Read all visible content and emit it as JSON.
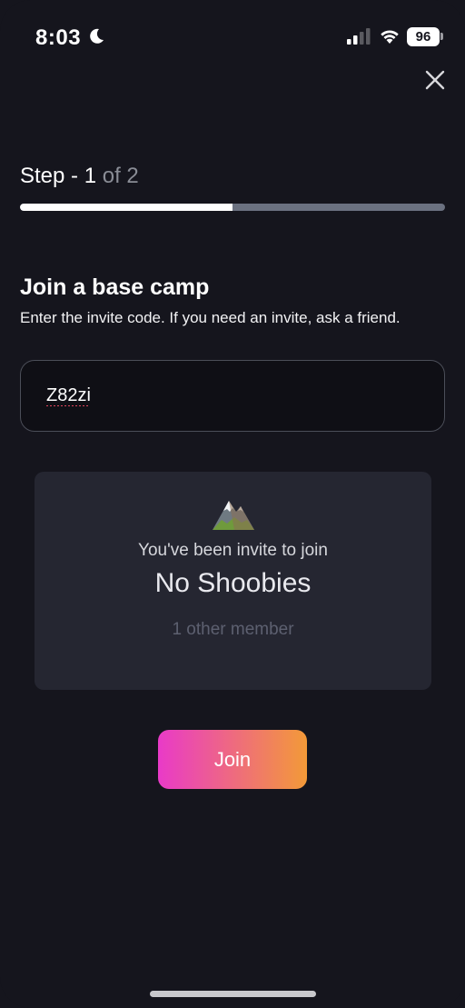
{
  "status_bar": {
    "time": "8:03",
    "battery": "96",
    "icons": [
      "moon-icon",
      "cellular-signal-icon",
      "wifi-icon",
      "battery-icon"
    ]
  },
  "header": {
    "close_icon": "close-icon"
  },
  "step": {
    "prefix": "Step - 1",
    "suffix": " of 2",
    "progress": 0.5
  },
  "form": {
    "heading": "Join a base camp",
    "subtext": "Enter the invite code. If you need an invite, ask a friend.",
    "code_value": "Z82zi"
  },
  "invite_card": {
    "icon": "mountain-icon",
    "message": "You've been invite to join",
    "camp_name": "No Shoobies",
    "members": "1 other member"
  },
  "actions": {
    "join_label": "Join"
  },
  "colors": {
    "background": "#15151d",
    "card": "#252631",
    "gradient_start": "#e93ac8",
    "gradient_end": "#f39a38"
  }
}
